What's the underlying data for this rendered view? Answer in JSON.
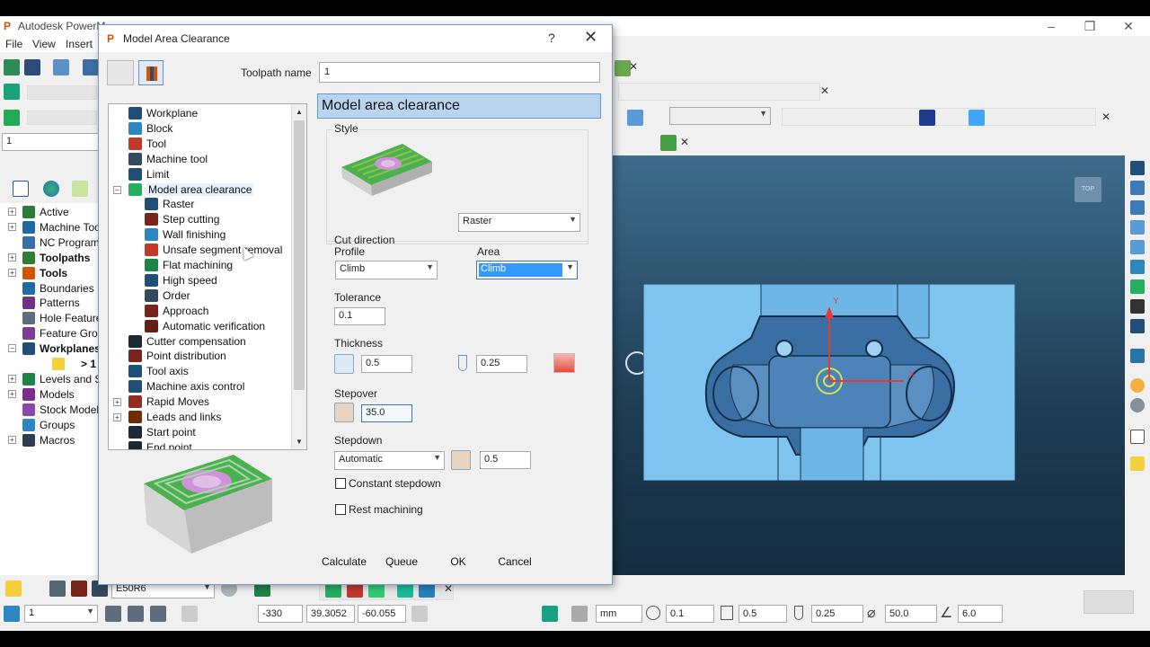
{
  "app": {
    "title": "Autodesk PowerM",
    "menu": [
      "File",
      "View",
      "Insert"
    ],
    "toolpath_combo": "1"
  },
  "explorer": {
    "items": [
      {
        "label": "Active",
        "bold": false,
        "expander": "+"
      },
      {
        "label": "Machine Too",
        "bold": false,
        "expander": "+"
      },
      {
        "label": "NC Programs",
        "bold": false,
        "expander": ""
      },
      {
        "label": "Toolpaths",
        "bold": true,
        "expander": "+"
      },
      {
        "label": "Tools",
        "bold": true,
        "expander": "+"
      },
      {
        "label": "Boundaries",
        "bold": false,
        "expander": ""
      },
      {
        "label": "Patterns",
        "bold": false,
        "expander": ""
      },
      {
        "label": "Hole Feature",
        "bold": false,
        "expander": ""
      },
      {
        "label": "Feature Grou",
        "bold": false,
        "expander": ""
      },
      {
        "label": "Workplanes",
        "bold": true,
        "expander": "−"
      },
      {
        "label": "> 1",
        "bold": true,
        "expander": ""
      },
      {
        "label": "Levels and Se",
        "bold": false,
        "expander": "+"
      },
      {
        "label": "Models",
        "bold": false,
        "expander": "+"
      },
      {
        "label": "Stock Models",
        "bold": false,
        "expander": ""
      },
      {
        "label": "Groups",
        "bold": false,
        "expander": ""
      },
      {
        "label": "Macros",
        "bold": false,
        "expander": "+"
      }
    ]
  },
  "dialog": {
    "title": "Model Area Clearance",
    "help": "?",
    "close": "✕",
    "toolpath_name_label": "Toolpath name",
    "toolpath_name_value": "1",
    "tree": [
      {
        "label": "Workplane",
        "indent": 0,
        "icon": "workplane-icon"
      },
      {
        "label": "Block",
        "indent": 0,
        "icon": "block-icon"
      },
      {
        "label": "Tool",
        "indent": 0,
        "icon": "tool-icon"
      },
      {
        "label": "Machine tool",
        "indent": 0,
        "icon": "machine-tool-icon"
      },
      {
        "label": "Limit",
        "indent": 0,
        "icon": "limit-icon"
      },
      {
        "label": "Model area clearance",
        "indent": 0,
        "icon": "area-clearance-icon",
        "selected": true
      },
      {
        "label": "Raster",
        "indent": 1,
        "icon": "raster-icon"
      },
      {
        "label": "Step cutting",
        "indent": 1,
        "icon": "step-cutting-icon"
      },
      {
        "label": "Wall finishing",
        "indent": 1,
        "icon": "wall-finishing-icon"
      },
      {
        "label": "Unsafe segment removal",
        "indent": 1,
        "icon": "unsafe-segment-icon"
      },
      {
        "label": "Flat machining",
        "indent": 1,
        "icon": "flat-machining-icon"
      },
      {
        "label": "High speed",
        "indent": 1,
        "icon": "high-speed-icon"
      },
      {
        "label": "Order",
        "indent": 1,
        "icon": "order-icon"
      },
      {
        "label": "Approach",
        "indent": 1,
        "icon": "approach-icon"
      },
      {
        "label": "Automatic verification",
        "indent": 1,
        "icon": "verification-icon"
      },
      {
        "label": "Cutter compensation",
        "indent": 0,
        "icon": "cutter-comp-icon"
      },
      {
        "label": "Point distribution",
        "indent": 0,
        "icon": "point-distribution-icon"
      },
      {
        "label": "Tool axis",
        "indent": 0,
        "icon": "tool-axis-icon"
      },
      {
        "label": "Machine axis control",
        "indent": 0,
        "icon": "machine-axis-icon"
      },
      {
        "label": "Rapid Moves",
        "indent": 0,
        "icon": "rapid-moves-icon",
        "expander": "+"
      },
      {
        "label": "Leads and links",
        "indent": 0,
        "icon": "leads-links-icon",
        "expander": "+"
      },
      {
        "label": "Start point",
        "indent": 0,
        "icon": "start-point-icon"
      },
      {
        "label": "End point",
        "indent": 0,
        "icon": "end-point-icon"
      }
    ],
    "panel_header": "Model area clearance",
    "style_label": "Style",
    "style_value": "Raster",
    "cut_direction_label": "Cut direction",
    "profile_label": "Profile",
    "profile_value": "Climb",
    "area_label": "Area",
    "area_value": "Climb",
    "tolerance_label": "Tolerance",
    "tolerance_value": "0.1",
    "thickness_label": "Thickness",
    "thickness_value": "0.5",
    "axial_thickness_value": "0.25",
    "stepover_label": "Stepover",
    "stepover_value": "35.0",
    "stepdown_label": "Stepdown",
    "stepdown_mode": "Automatic",
    "stepdown_value": "0.5",
    "constant_stepdown_label": "Constant stepdown",
    "rest_machining_label": "Rest machining",
    "buttons": {
      "calculate": "Calculate",
      "queue": "Queue",
      "ok": "OK",
      "cancel": "Cancel"
    }
  },
  "viewport": {
    "axis_y": "Y",
    "axis_x": "X",
    "view_badge": "TOP"
  },
  "statusbar": {
    "tool_name": "E50R6",
    "workplane": "1",
    "coord_x": "-330",
    "coord_y": "39.3052",
    "coord_z": "-60.055",
    "units": "mm",
    "tolerance": "0.1",
    "thickness": "0.5",
    "axial_thickness": "0.25",
    "diameter": "50.0",
    "tip_radius": "6.0"
  },
  "colors": {
    "accent": "#3c78b4",
    "panel_header": "#b8d4ef",
    "model_blue": "#7fc3ef",
    "toolpath_green": "#7ed957"
  }
}
